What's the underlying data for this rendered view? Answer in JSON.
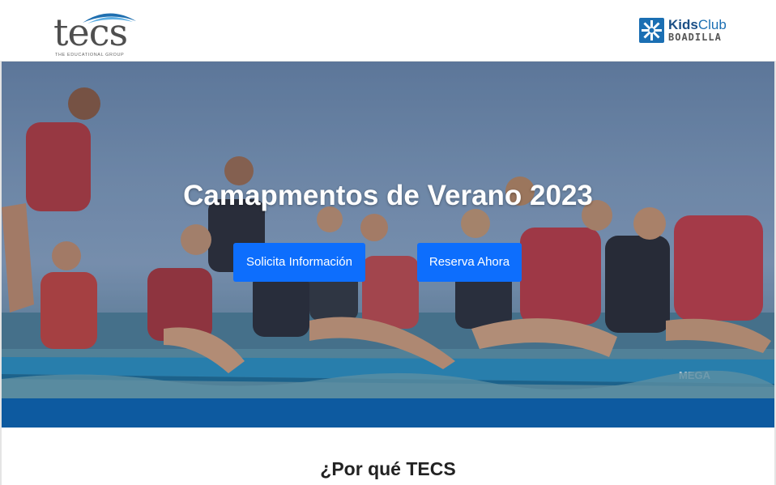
{
  "header": {
    "logo_main": {
      "word": "tecs",
      "tagline": "THE EDUCATIONAL GROUP"
    },
    "logo_partner": {
      "kids": "Kids",
      "club": "Club",
      "town": "BOADILLA"
    }
  },
  "hero": {
    "title": "Camapmentos de Verano 2023",
    "buttons": {
      "info_label": "Solicita Información",
      "book_label": "Reserva Ahora"
    },
    "board_text": "MEGA"
  },
  "section": {
    "title": "¿Por qué TECS"
  },
  "colors": {
    "primary_button": "#0d6efd",
    "band": "#0d5aa0",
    "brand_blue": "#1b6fb3"
  }
}
